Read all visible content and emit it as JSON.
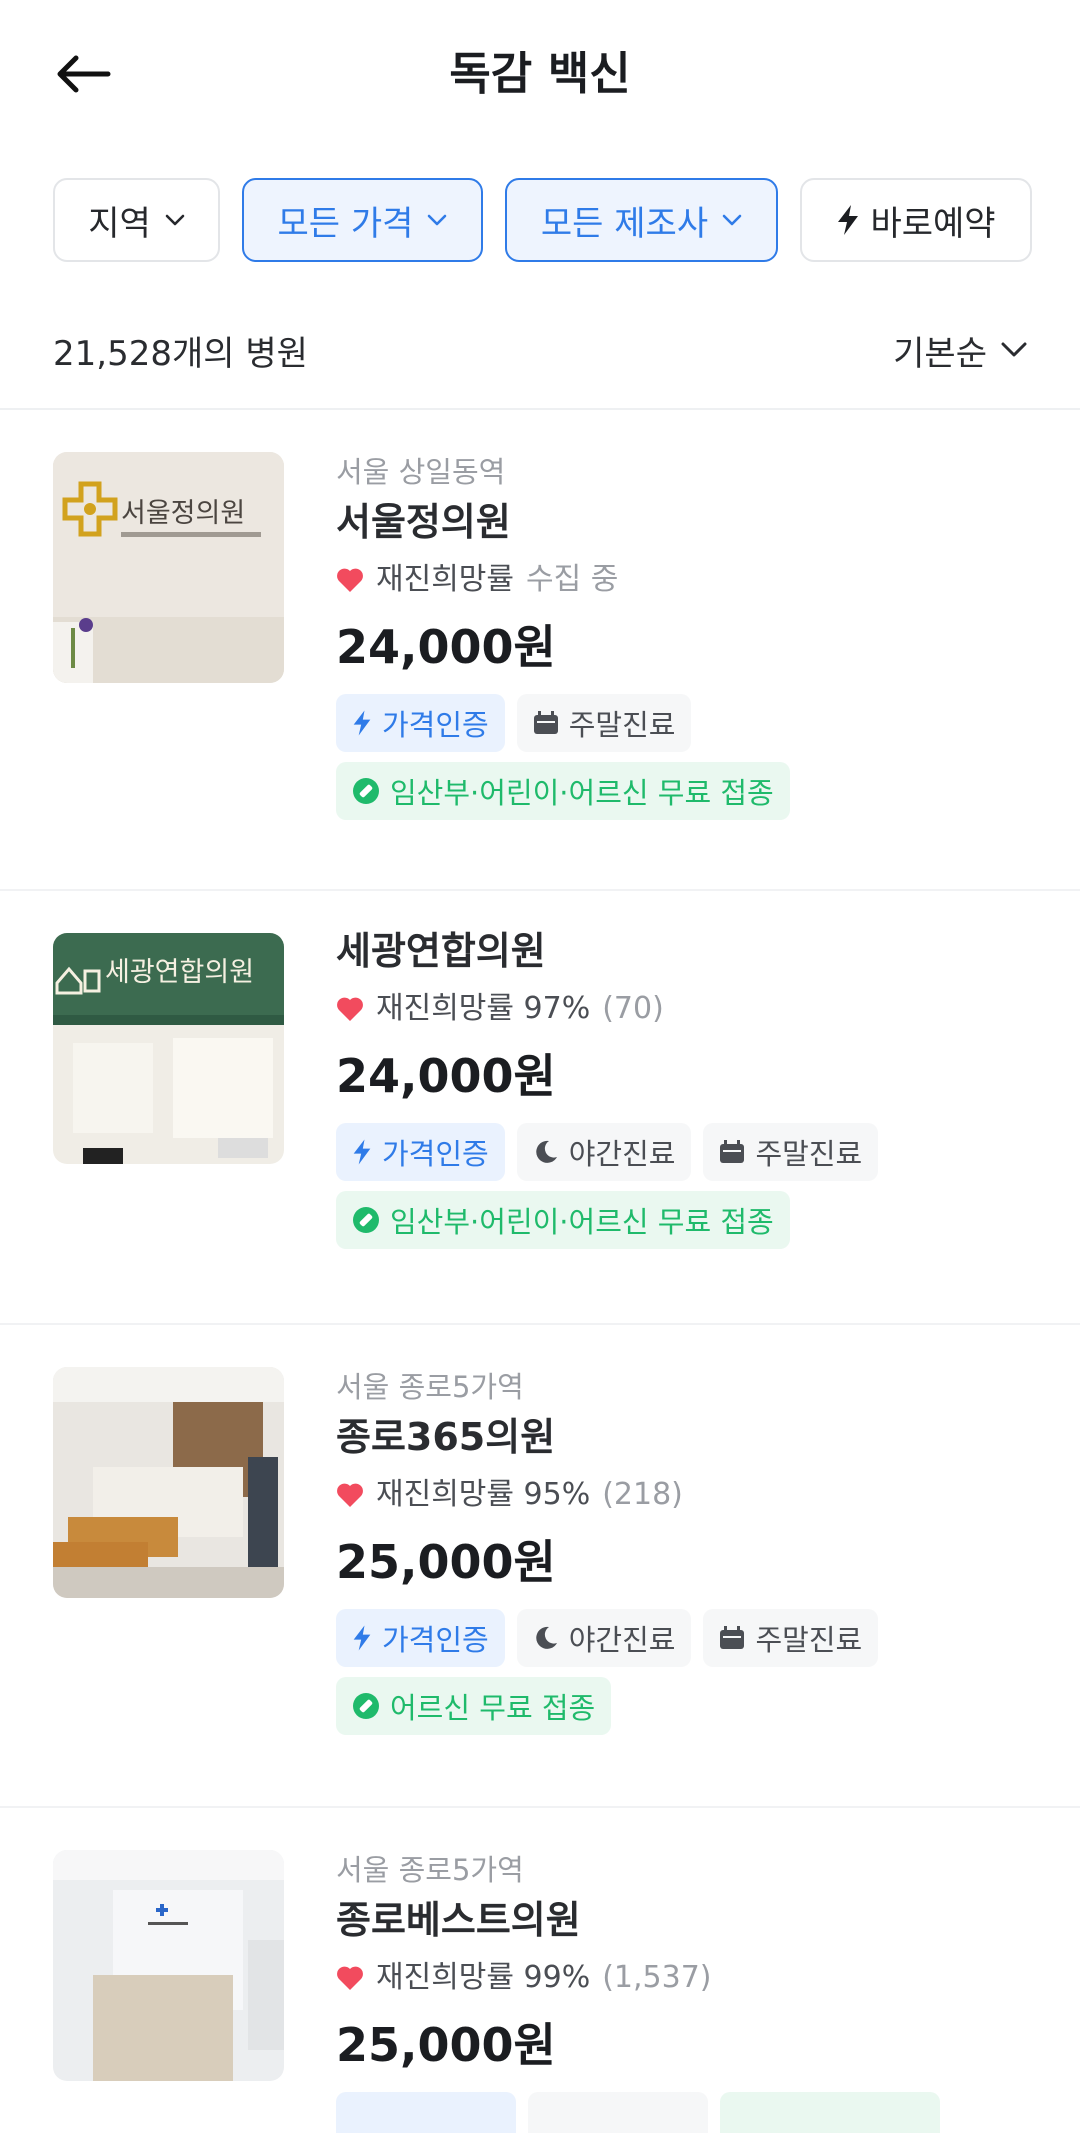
{
  "header": {
    "title": "독감 백신"
  },
  "filters": [
    {
      "label": "지역",
      "active": false,
      "icon": "chevron-down-icon"
    },
    {
      "label": "모든 가격",
      "active": true,
      "icon": "chevron-down-icon"
    },
    {
      "label": "모든 제조사",
      "active": true,
      "icon": "chevron-down-icon"
    },
    {
      "label": "바로예약",
      "active": false,
      "icon": "lightning-icon"
    }
  ],
  "summary": {
    "count": "21,528개의 병원",
    "sort": "기본순"
  },
  "hospitals": [
    {
      "location": "서울 상일동역",
      "name": "서울정의원",
      "rating_label": "재진희망률",
      "rating_value": "수집 중",
      "price": "24,000원",
      "tags": [
        "가격인증",
        "주말진료"
      ],
      "free": "임산부·어린이·어르신 무료 접종",
      "thumb_text": "서울정의원"
    },
    {
      "location": "",
      "name": "세광연합의원",
      "rating_label": "재진희망률 97%",
      "rating_value": "(70)",
      "price": "24,000원",
      "tags": [
        "가격인증",
        "야간진료",
        "주말진료"
      ],
      "free": "임산부·어린이·어르신 무료 접종",
      "thumb_text": "세광연합의원"
    },
    {
      "location": "서울 종로5가역",
      "name": "종로365의원",
      "rating_label": "재진희망률 95%",
      "rating_value": "(218)",
      "price": "25,000원",
      "tags": [
        "가격인증",
        "야간진료",
        "주말진료"
      ],
      "free": "어르신 무료 접종"
    },
    {
      "location": "서울 종로5가역",
      "name": "종로베스트의원",
      "rating_label": "재진희망률 99%",
      "rating_value": "(1,537)",
      "price": "25,000원"
    }
  ],
  "colors": {
    "accent": "#2f7be8",
    "green": "#1fba6b",
    "heart": "#f24b5e"
  }
}
